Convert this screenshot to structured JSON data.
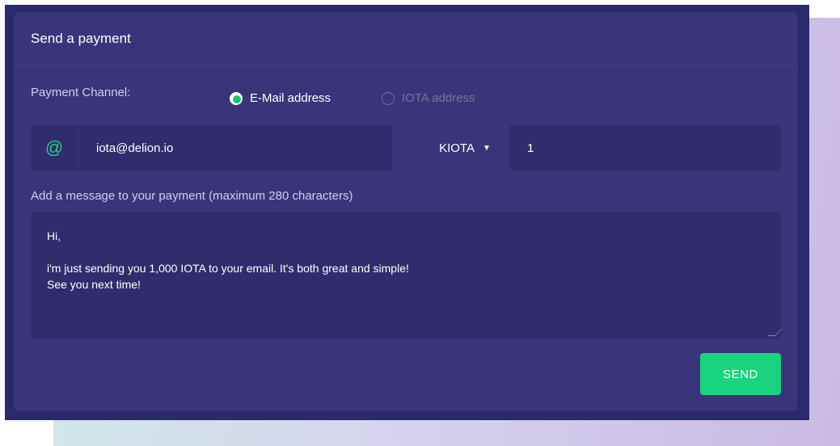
{
  "header": {
    "title": "Send a payment"
  },
  "payment_channel": {
    "label": "Payment Channel:",
    "options": [
      {
        "label": "E-Mail address",
        "selected": true
      },
      {
        "label": "IOTA address",
        "selected": false
      }
    ]
  },
  "recipient": {
    "icon": "@",
    "value": "iota@delion.io"
  },
  "amount": {
    "unit": "KIOTA",
    "caret": "▼",
    "value": "1"
  },
  "message": {
    "label": "Add a message to your payment (maximum 280 characters)",
    "lines": [
      "Hi,",
      "",
      "i'm just sending you 1,000 IOTA to your email. It's both great and simple!",
      "See you next time!"
    ]
  },
  "actions": {
    "send_label": "SEND"
  },
  "colors": {
    "accent": "#19d37f",
    "card_background": "#3a347a",
    "input_background": "#312c6c"
  }
}
